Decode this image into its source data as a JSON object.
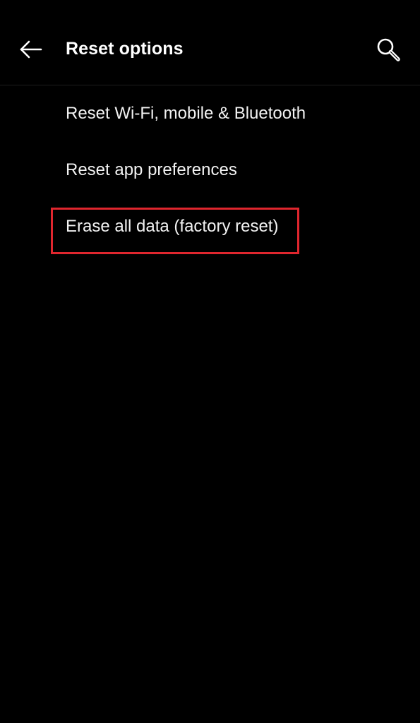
{
  "header": {
    "title": "Reset options",
    "back_icon": "arrow-left-icon",
    "search_icon": "search-icon"
  },
  "menu": {
    "items": [
      {
        "label": "Reset Wi-Fi, mobile & Bluetooth"
      },
      {
        "label": "Reset app preferences"
      },
      {
        "label": "Erase all data (factory reset)"
      }
    ]
  },
  "colors": {
    "background": "#000000",
    "text": "#ffffff",
    "highlight": "#e0262e"
  }
}
